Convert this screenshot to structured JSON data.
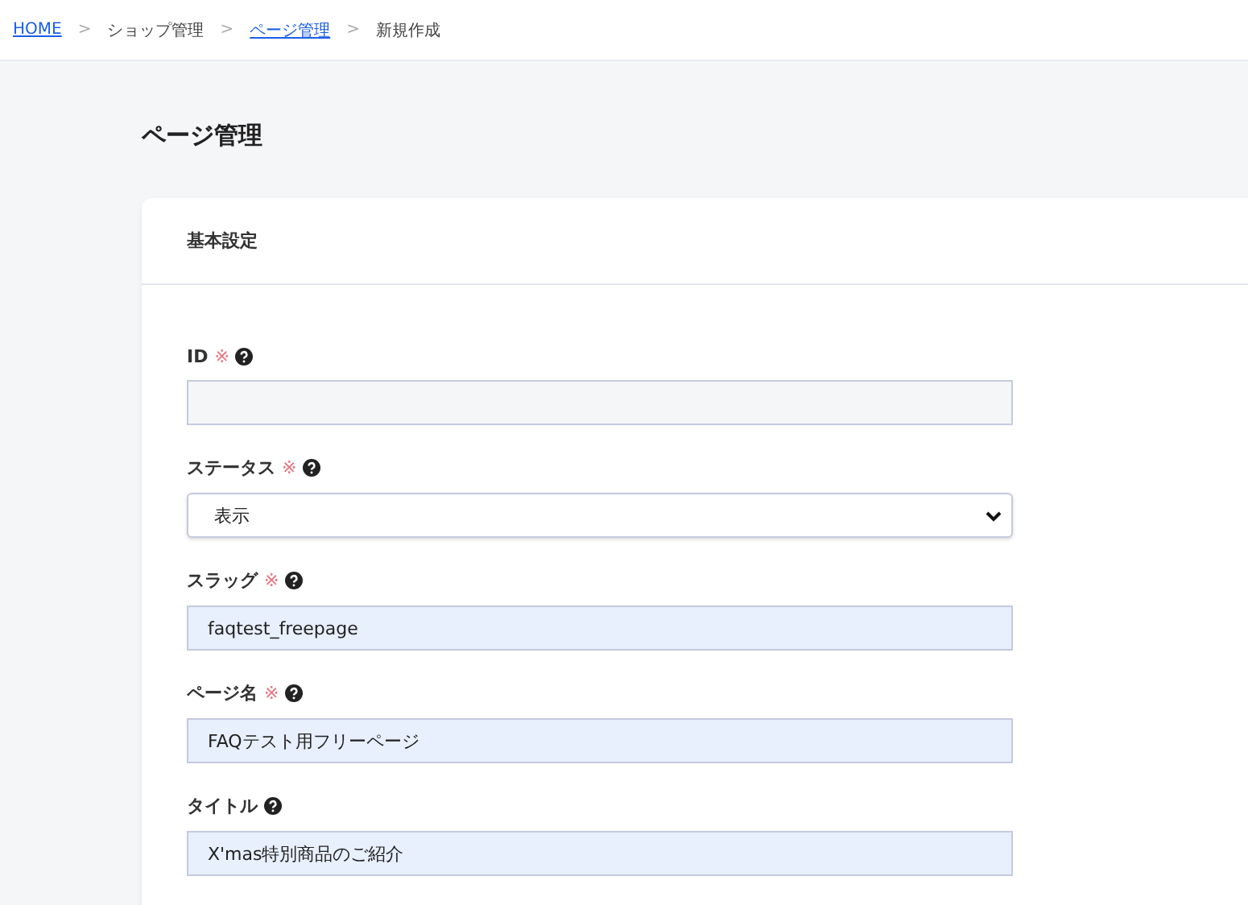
{
  "breadcrumbs": [
    {
      "kind": "link",
      "text": "HOME"
    },
    {
      "kind": "separator",
      "text": ">"
    },
    {
      "kind": "text",
      "text": "ショップ管理"
    },
    {
      "kind": "separator",
      "text": ">"
    },
    {
      "kind": "link",
      "text": "ページ管理"
    },
    {
      "kind": "separator",
      "text": ">"
    },
    {
      "kind": "text",
      "text": "新規作成"
    }
  ],
  "page_title": "ページ管理",
  "card": {
    "title": "基本設定",
    "fields": [
      {
        "label": "ID",
        "required_mark": "※",
        "kind": "text",
        "highlighted": false
      },
      {
        "label": "ステータス",
        "required_mark": "※",
        "kind": "select",
        "value": "表示",
        "highlighted": false
      },
      {
        "label": "スラッグ",
        "required_mark": "※",
        "kind": "text",
        "value": "faqtest_freepage",
        "highlighted": true
      },
      {
        "label": "ページ名",
        "required_mark": "※",
        "kind": "text",
        "value": "FAQテスト用フリーページ",
        "highlighted": true
      },
      {
        "label": "タイトル",
        "kind": "text",
        "value": "X'mas特別商品のご紹介",
        "highlighted": true
      }
    ]
  }
}
